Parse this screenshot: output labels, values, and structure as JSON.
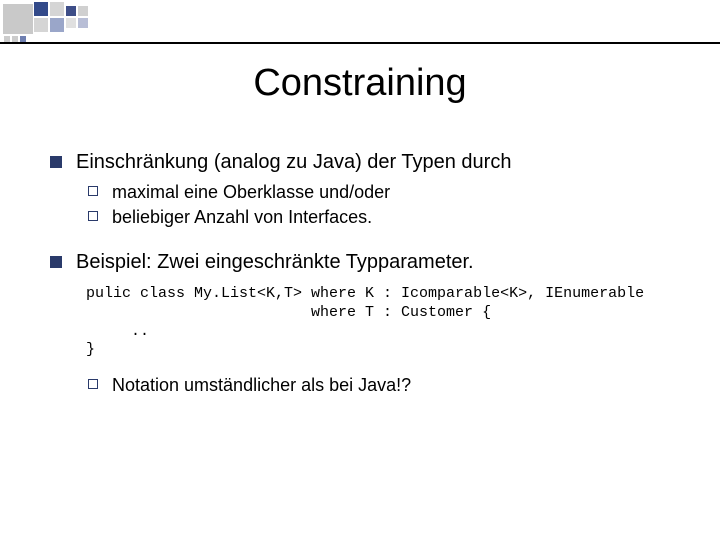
{
  "title": "Constraining",
  "bullets": {
    "p1": {
      "text": "Einschränkung (analog zu Java) der Typen durch",
      "subs": {
        "a": "maximal eine Oberklasse und/oder",
        "b": "beliebiger Anzahl von Interfaces."
      }
    },
    "p2": {
      "text": "Beispiel: Zwei eingeschränkte Typparameter.",
      "code": "pulic class My.List<K,T> where K : Icomparable<K>, IEnumerable\n                         where T : Customer {\n     ..\n}",
      "sub": "Notation umständlicher als bei Java!?"
    }
  }
}
